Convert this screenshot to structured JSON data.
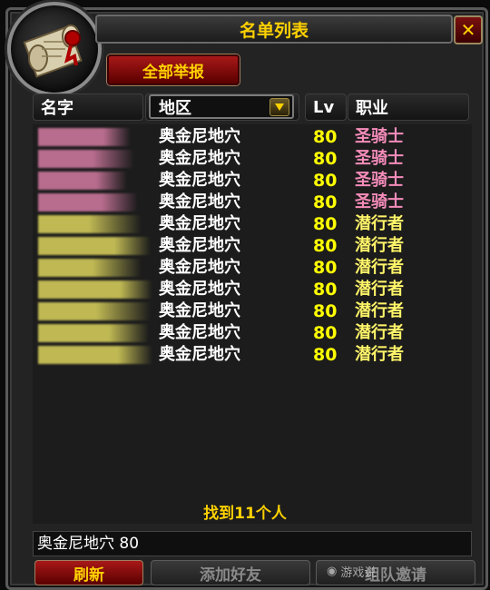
{
  "window": {
    "title": "名单列表"
  },
  "buttons": {
    "report_all": "全部举报",
    "refresh": "刷新",
    "add_friend": "添加好友",
    "group_invite": "组队邀请"
  },
  "columns": {
    "name": "名字",
    "zone": "地区",
    "level": "Lv",
    "class": "职业"
  },
  "zone_dropdown": {
    "selected": "地区"
  },
  "rows": [
    {
      "zone": "奥金尼地穴",
      "level": "80",
      "class": "圣骑士",
      "class_color": "#f58cba"
    },
    {
      "zone": "奥金尼地穴",
      "level": "80",
      "class": "圣骑士",
      "class_color": "#f58cba"
    },
    {
      "zone": "奥金尼地穴",
      "level": "80",
      "class": "圣骑士",
      "class_color": "#f58cba"
    },
    {
      "zone": "奥金尼地穴",
      "level": "80",
      "class": "圣骑士",
      "class_color": "#f58cba"
    },
    {
      "zone": "奥金尼地穴",
      "level": "80",
      "class": "潜行者",
      "class_color": "#fff569"
    },
    {
      "zone": "奥金尼地穴",
      "level": "80",
      "class": "潜行者",
      "class_color": "#fff569"
    },
    {
      "zone": "奥金尼地穴",
      "level": "80",
      "class": "潜行者",
      "class_color": "#fff569"
    },
    {
      "zone": "奥金尼地穴",
      "level": "80",
      "class": "潜行者",
      "class_color": "#fff569"
    },
    {
      "zone": "奥金尼地穴",
      "level": "80",
      "class": "潜行者",
      "class_color": "#fff569"
    },
    {
      "zone": "奥金尼地穴",
      "level": "80",
      "class": "潜行者",
      "class_color": "#fff569"
    },
    {
      "zone": "奥金尼地穴",
      "level": "80",
      "class": "潜行者",
      "class_color": "#fff569"
    }
  ],
  "status": {
    "found": "找到11个人"
  },
  "search": {
    "value": "奥金尼地穴 80"
  },
  "watermark": {
    "text": "游戏说"
  },
  "colors": {
    "gold": "#ffd100",
    "level_yellow": "#ffff00",
    "paladin_pink": "#f58cba",
    "rogue_yellow": "#fff569"
  },
  "icons": {
    "portrait": "scroll-icon",
    "close": "close-icon",
    "dropdown": "chevron-down-icon"
  }
}
